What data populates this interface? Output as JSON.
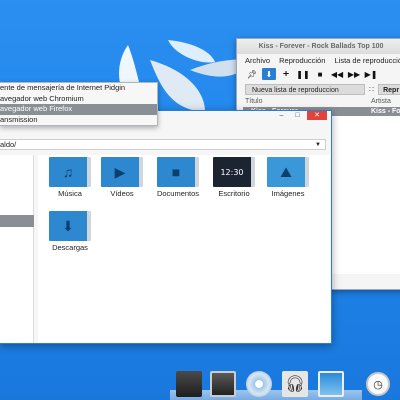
{
  "player": {
    "title": "Kiss - Forever - Rock Ballads Top 100",
    "menu": [
      "Archivo",
      "Reproducción",
      "Lista de reproducción"
    ],
    "toolbar": {
      "pin": "pin-icon",
      "shuffle": "shuffle-icon",
      "add": "add-icon",
      "pause": "pause-icon",
      "stop": "stop-icon",
      "rewind": "rewind-icon",
      "forward": "forward-icon",
      "next": "next-icon"
    },
    "playlist_select": "Nueva lista de reproduccion",
    "repeat_label": "Repr",
    "columns": {
      "title": "Título",
      "artist": "Artista"
    },
    "track": {
      "title": "Kiss - Forever",
      "artist": "Kiss - Fo"
    }
  },
  "context_menu": {
    "items": [
      "ente de mensajería de Internet Pidgin",
      "avegador web Chromium",
      "avegador web Firefox",
      "ansmission"
    ],
    "highlighted_index": 2
  },
  "file_manager": {
    "path": "aldo/",
    "folders": [
      {
        "label": "Música",
        "icon": "music-icon"
      },
      {
        "label": "Vídeos",
        "icon": "video-icon"
      },
      {
        "label": "Documentos",
        "icon": "document-icon"
      },
      {
        "label": "Escritorio",
        "icon": "desktop-icon",
        "clock": "12:30"
      },
      {
        "label": "Imágenes",
        "icon": "image-icon"
      },
      {
        "label": "Descargas",
        "icon": "download-icon"
      }
    ]
  },
  "dock": {
    "apps": [
      "terminal-app",
      "monitor-app",
      "disc-app",
      "headphones-app",
      "picture-app",
      "clock-app"
    ]
  }
}
